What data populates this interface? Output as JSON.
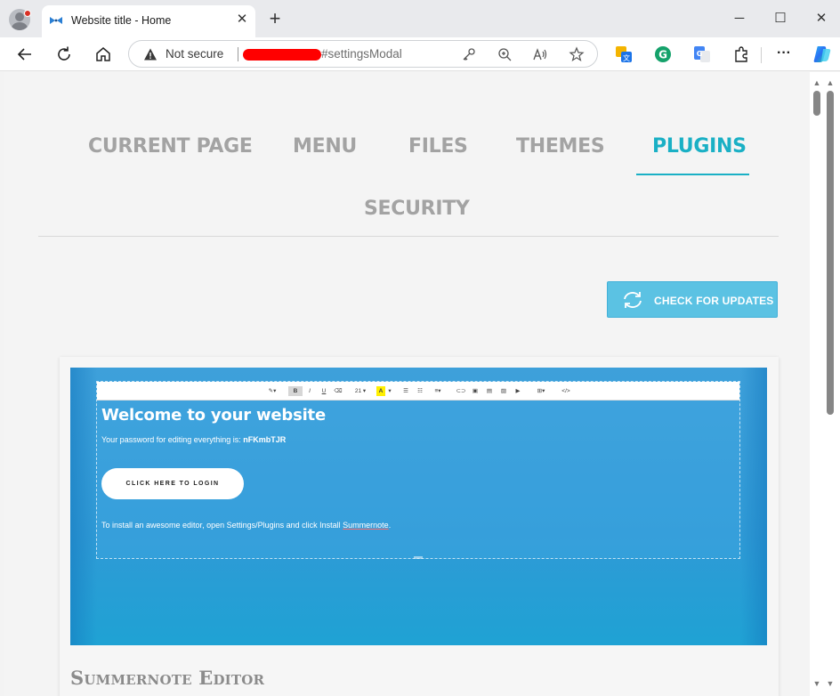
{
  "browser": {
    "tab_title": "Website title - Home",
    "tab_close": "✕",
    "new_tab": "+",
    "security_label": "Not secure",
    "url_suffix": "#settingsModal",
    "window": {
      "minimize": "─",
      "maximize": "☐",
      "close": "✕"
    },
    "more_menu": "···"
  },
  "settings_nav": {
    "tabs": [
      {
        "label": "CURRENT PAGE"
      },
      {
        "label": "MENU"
      },
      {
        "label": "FILES"
      },
      {
        "label": "THEMES"
      },
      {
        "label": "PLUGINS",
        "active": true
      },
      {
        "label": "SECURITY"
      }
    ]
  },
  "actions": {
    "check_updates": "CHECK FOR UPDATES"
  },
  "plugin_card": {
    "preview": {
      "heading": "Welcome to your website",
      "password_text": "Your password for editing everything is: ",
      "password_value": "nFKmbTJR",
      "login_button": "CLICK HERE TO LOGIN",
      "install_text_before": "To install an awesome editor, open Settings/Plugins and click Install ",
      "install_text_link": "Summernote",
      "install_text_after": ".",
      "toolbar_font_size": "21"
    },
    "title": "Summernote Editor"
  },
  "colors": {
    "accent": "#1ab0c5",
    "button": "#5bc2e3",
    "inactive_tab": "#a3a3a3"
  }
}
